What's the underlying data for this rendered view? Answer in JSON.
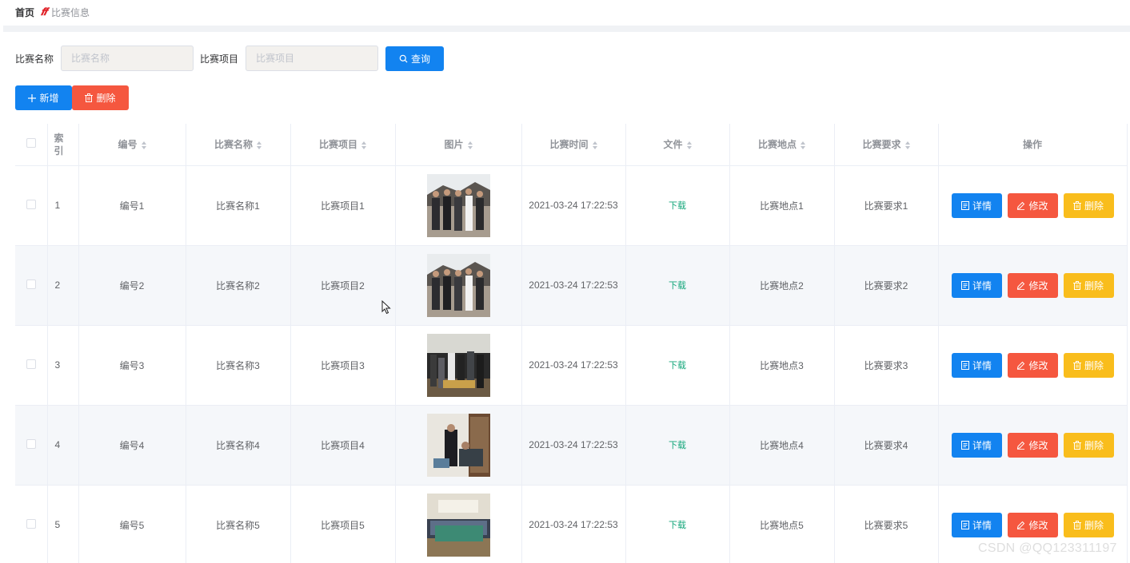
{
  "breadcrumb": {
    "home": "首页",
    "separator": "𝒇𝒇",
    "current": "比赛信息"
  },
  "search": {
    "name_label": "比赛名称",
    "name_placeholder": "比赛名称",
    "item_label": "比赛项目",
    "item_placeholder": "比赛项目",
    "query_label": "查询",
    "query_icon": "search-icon"
  },
  "actions": {
    "add_label": "新增",
    "add_icon": "plus-icon",
    "delete_label": "删除",
    "delete_icon": "trash-icon"
  },
  "table": {
    "columns": [
      "索引",
      "编号",
      "比赛名称",
      "比赛项目",
      "图片",
      "比赛时间",
      "文件",
      "比赛地点",
      "比赛要求",
      "操作"
    ],
    "rows": [
      {
        "index": "1",
        "code": "编号1",
        "name": "比赛名称1",
        "item": "比赛项目1",
        "time": "2021-03-24 17:22:53",
        "file": "下载",
        "place": "比赛地点1",
        "req": "比赛要求1"
      },
      {
        "index": "2",
        "code": "编号2",
        "name": "比赛名称2",
        "item": "比赛项目2",
        "time": "2021-03-24 17:22:53",
        "file": "下载",
        "place": "比赛地点2",
        "req": "比赛要求2"
      },
      {
        "index": "3",
        "code": "编号3",
        "name": "比赛名称3",
        "item": "比赛项目3",
        "time": "2021-03-24 17:22:53",
        "file": "下载",
        "place": "比赛地点3",
        "req": "比赛要求3"
      },
      {
        "index": "4",
        "code": "编号4",
        "name": "比赛名称4",
        "item": "比赛项目4",
        "time": "2021-03-24 17:22:53",
        "file": "下载",
        "place": "比赛地点4",
        "req": "比赛要求4"
      },
      {
        "index": "5",
        "code": "编号5",
        "name": "比赛名称5",
        "item": "比赛项目5",
        "time": "2021-03-24 17:22:53",
        "file": "下载",
        "place": "比赛地点5",
        "req": "比赛要求5"
      }
    ],
    "row_actions": {
      "detail": "详情",
      "edit": "修改",
      "remove": "删除"
    }
  },
  "watermark": "CSDN @QQ123311197",
  "colors": {
    "primary": "#1283f0",
    "danger": "#f5573f",
    "warning": "#f9bd1c",
    "success_text": "#13a67a",
    "stripe": "#f5f7fa",
    "border": "#ebeef5"
  }
}
